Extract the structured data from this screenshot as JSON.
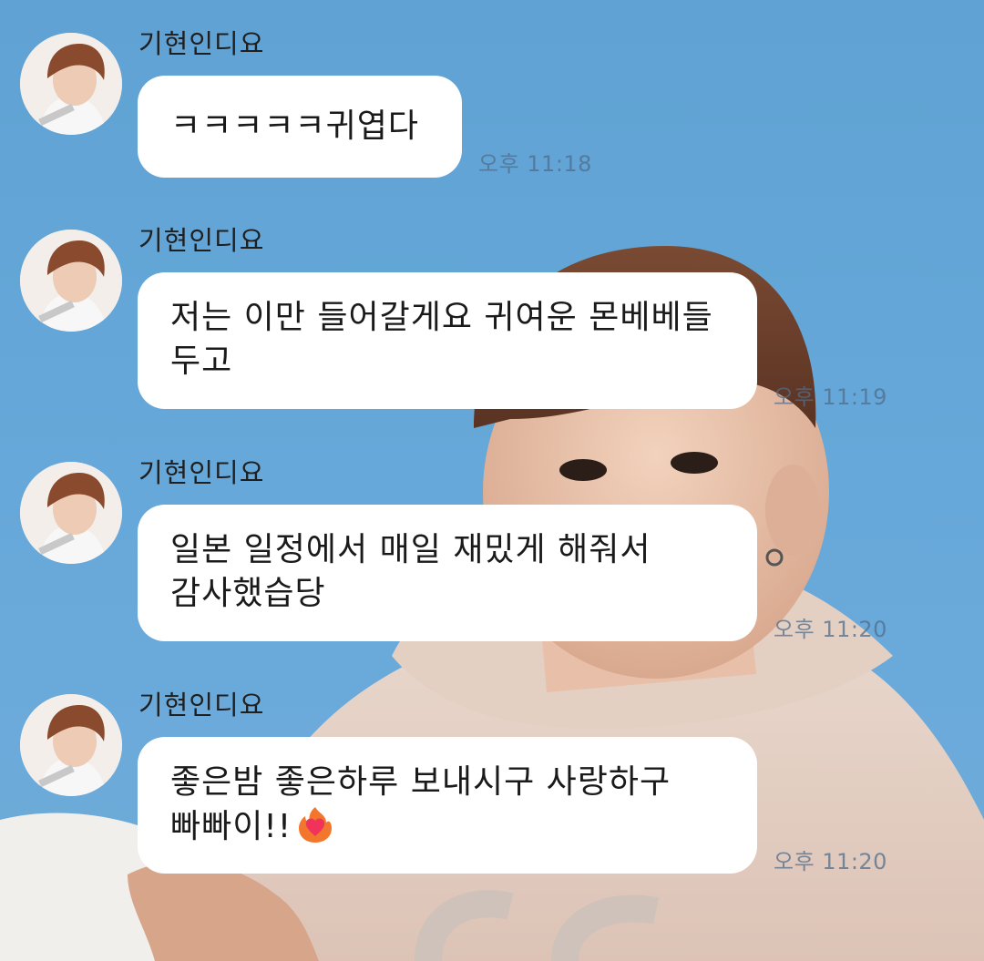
{
  "chat": {
    "messages": [
      {
        "sender": "기현인디요",
        "lines": [
          "ㅋㅋㅋㅋㅋ귀엽다"
        ],
        "time": "오후 11:18"
      },
      {
        "sender": "기현인디요",
        "lines": [
          "저는 이만 들어갈게요 귀여운 몬베베들",
          "두고"
        ],
        "time": "오후 11:19"
      },
      {
        "sender": "기현인디요",
        "lines": [
          "일본 일정에서 매일 재밌게 해줘서",
          "감사했습당"
        ],
        "time": "오후 11:20"
      },
      {
        "sender": "기현인디요",
        "lines": [
          "좋은밤 좋은하루 보내시구 사랑하구",
          "빠빠이!!"
        ],
        "emoji": "heart-on-fire-icon",
        "time": "오후 11:20"
      }
    ]
  },
  "colors": {
    "background": "#64a7d8",
    "bubble": "#ffffff",
    "text": "#1a1a1a",
    "timestamp": "#6e8aa6"
  }
}
